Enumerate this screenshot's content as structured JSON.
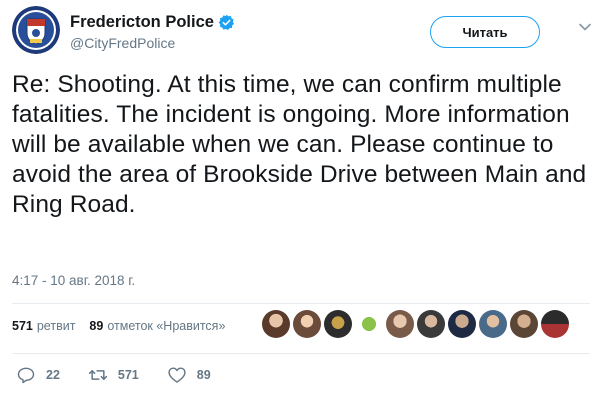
{
  "author": {
    "name": "Fredericton Police",
    "handle": "@CityFredPolice",
    "avatar_icon": "police-crest-icon",
    "verified_icon": "verified-badge-icon"
  },
  "follow_button": {
    "label": "Читать"
  },
  "tweet": {
    "text": "Re: Shooting. At this time, we can confirm multiple fatalities. The incident is ongoing. More information will be available when we can. Please continue to avoid the area of Brookside Drive between Main and Ring Road.",
    "timestamp": "4:17 - 10 авг. 2018 г."
  },
  "stats": {
    "retweets_count": "571",
    "retweets_label": "ретвит",
    "likes_count": "89",
    "likes_label": "отметок «Нравится»"
  },
  "actions": {
    "reply_count": "22",
    "retweet_count": "571",
    "like_count": "89"
  },
  "colors": {
    "accent": "#1da1f2",
    "text": "#14171a",
    "muted": "#657786",
    "divider": "#e6ecf0"
  }
}
